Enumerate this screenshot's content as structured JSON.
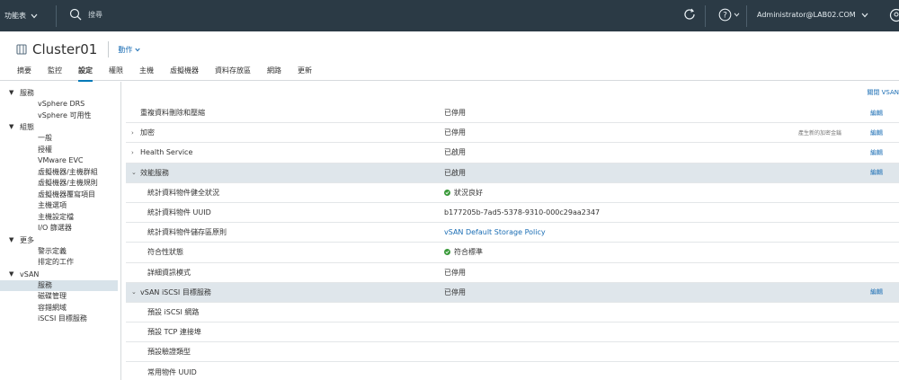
{
  "topbar": {
    "menu_label": "功能表",
    "search_placeholder": "搜尋",
    "user": "Administrator@LAB02.COM"
  },
  "object": {
    "name": "Cluster01",
    "actions_label": "動作"
  },
  "tabs": [
    {
      "label": "摘要"
    },
    {
      "label": "監控"
    },
    {
      "label": "設定"
    },
    {
      "label": "權限"
    },
    {
      "label": "主機"
    },
    {
      "label": "虛擬機器"
    },
    {
      "label": "資料存放區"
    },
    {
      "label": "網路"
    },
    {
      "label": "更新"
    }
  ],
  "nav": {
    "groups": [
      {
        "title": "服務",
        "items": [
          "vSphere DRS",
          "vSphere 可用性"
        ]
      },
      {
        "title": "組態",
        "items": [
          "一般",
          "授權",
          "VMware EVC",
          "虛擬機器/主機群組",
          "虛擬機器/主機規則",
          "虛擬機器覆寫項目",
          "主機選項",
          "主機設定檔",
          "I/O 篩選器"
        ]
      },
      {
        "title": "更多",
        "items": [
          "警示定義",
          "排定的工作"
        ]
      },
      {
        "title": "vSAN",
        "items": [
          "服務",
          "磁碟管理",
          "容錯網域",
          "iSCSI 目標服務"
        ]
      }
    ],
    "selected": "服務"
  },
  "content": {
    "turn_off_label": "關閉 VSAN",
    "edit_label": "編輯",
    "rows": [
      {
        "label": "重複資料刪除和壓縮",
        "value": "已停用",
        "edit": true
      },
      {
        "label": "加密",
        "value": "已停用",
        "note": "產生新的加密金鑰",
        "edit": true
      },
      {
        "label": "Health Service",
        "value": "已啟用",
        "edit": true
      },
      {
        "label": "效能服務",
        "value": "已啟用",
        "edit": true
      },
      {
        "label": "統計資料物件健全狀況",
        "value": "狀況良好"
      },
      {
        "label": "統計資料物件 UUID",
        "value": "b177205b-7ad5-5378-9310-000c29aa2347"
      },
      {
        "label": "統計資料物件儲存區原則",
        "value": "vSAN Default Storage Policy"
      },
      {
        "label": "符合性狀態",
        "value": "符合標準"
      },
      {
        "label": "詳細資訊模式",
        "value": "已停用"
      },
      {
        "label": "vSAN iSCSI 目標服務",
        "value": "已停用",
        "edit": true
      },
      {
        "label": "預設 iSCSI 網路",
        "value": ""
      },
      {
        "label": "預設 TCP 連接埠",
        "value": ""
      },
      {
        "label": "預設驗證類型",
        "value": ""
      },
      {
        "label": "常用物件 UUID",
        "value": ""
      }
    ]
  }
}
